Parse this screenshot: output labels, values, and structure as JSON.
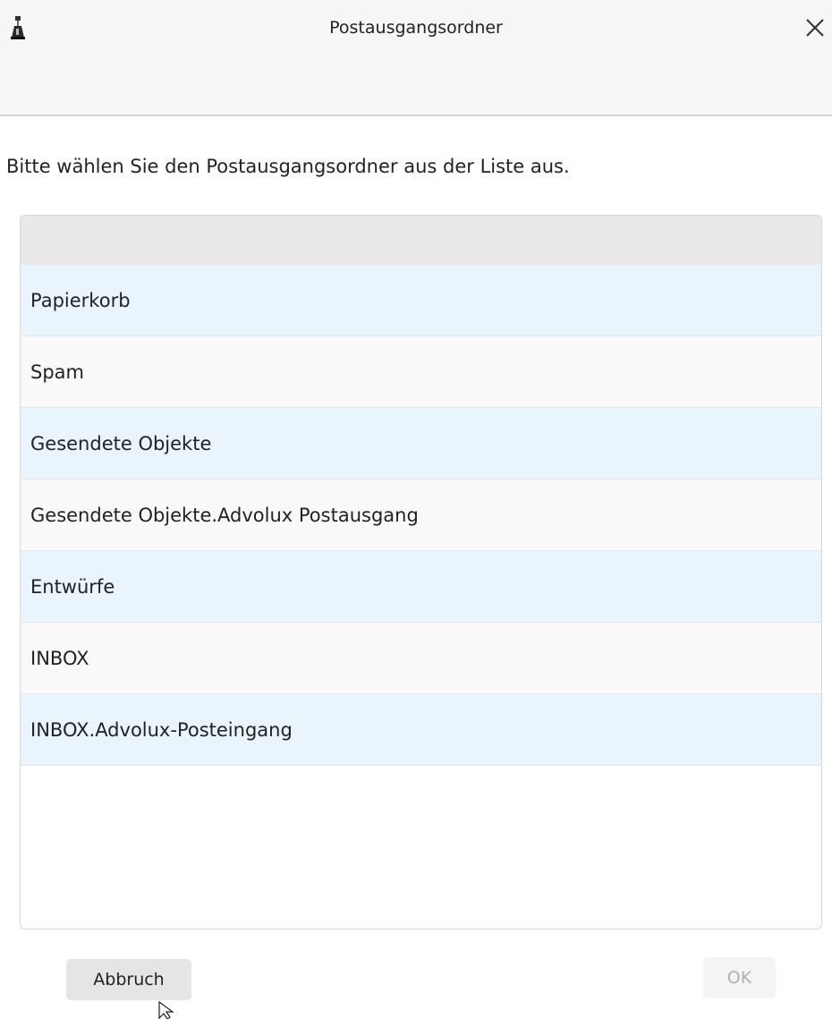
{
  "window": {
    "title": "Postausgangsordner",
    "app_icon": "inkwell-icon",
    "close_icon": "close-icon"
  },
  "prompt": "Bitte wählen Sie den Postausgangsordner aus der Liste aus.",
  "folders": [
    "Papierkorb",
    "Spam",
    "Gesendete Objekte",
    "Gesendete Objekte.Advolux Postausgang",
    "Entwürfe",
    "INBOX",
    "INBOX.Advolux-Posteingang"
  ],
  "buttons": {
    "cancel_label": "Abbruch",
    "ok_label": "OK",
    "ok_enabled": false
  },
  "colors": {
    "row_alt": "#eaf4fc",
    "row_plain": "#f9f9f9"
  }
}
